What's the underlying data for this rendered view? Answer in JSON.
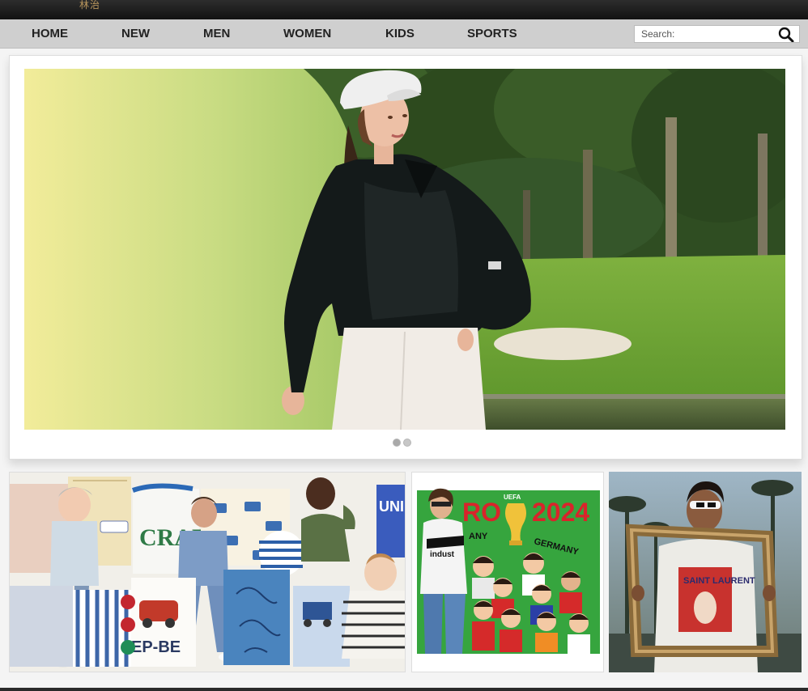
{
  "brand": {
    "logo_text": "林治"
  },
  "nav": {
    "items": [
      {
        "label": "HOME"
      },
      {
        "label": "NEW"
      },
      {
        "label": "MEN"
      },
      {
        "label": "WOMEN"
      },
      {
        "label": "KIDS"
      },
      {
        "label": "SPORTS"
      }
    ],
    "search": {
      "placeholder": "Search:",
      "value": ""
    }
  },
  "hero": {
    "slide_count": 2,
    "active_slide": 1
  },
  "tiles": {
    "kids": {
      "shirt_text": "CRAFT",
      "brand_text": "UNI FU",
      "sign_text": "EP-BE"
    },
    "euro": {
      "banner_left": "RO",
      "banner_right": "2024",
      "org": "UEFA",
      "country_left": "ANY",
      "country_right": "GERMANY",
      "shirt_text": "indust"
    },
    "saint": {
      "shirt_text": "SAINT LAURENT"
    }
  },
  "colors": {
    "nav_bg": "#cfcfcf",
    "topbar": "#1a1a1a",
    "euro_green": "#3aa23f",
    "euro_red": "#d9242b"
  }
}
